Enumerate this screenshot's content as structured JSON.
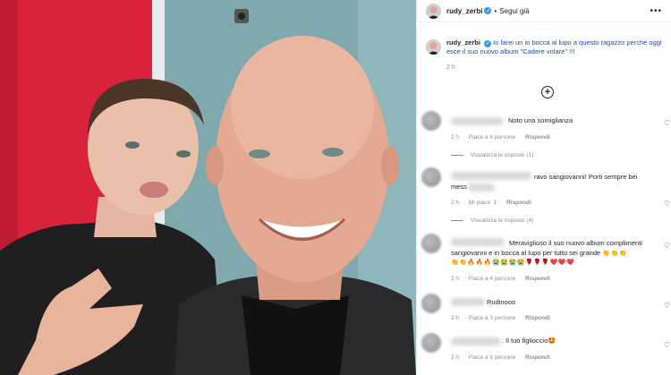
{
  "post": {
    "username": "rudy_zerbi",
    "follow_state": "Segui già",
    "caption": "Io farei un in bocca al lupo a questo ragazzo perché oggi esce il suo nuovo album \"Cadere volare\" !!!",
    "time": "2 h"
  },
  "comments": [
    {
      "text": "Noto una somiglianza",
      "time": "2 h",
      "likes": "Piace a 8 persone",
      "reply": "Rispondi"
    },
    {
      "text": "ravo sangiovanni! Porti sempre bei",
      "text2": "mess",
      "time": "2 h",
      "likes": "Mi piace: 1",
      "reply": "Rispondi",
      "replies_view": "Visualizza le risposte (1)"
    },
    {
      "text": "Meraviglioso il suo nuovo album complimenti",
      "text2": "sangiovanni e in bocca al lupo per tutto sei grande",
      "emoji_trail": "👏👏👏",
      "emoji_line": "👏👏🔥🔥🔥😭😭😭😭🌹🌹🌹❤️❤️❤️",
      "time": "2 h",
      "likes": "Piace a 4 persone",
      "reply": "Rispondi",
      "replies_view_above": "Visualizza le risposte (4)"
    },
    {
      "text": "Rudinooo",
      "time": "2 h",
      "likes": "Piace a 3 persone",
      "reply": "Rispondi"
    },
    {
      "text": ". Il tuo figlioccio🤩",
      "time": "2 h",
      "likes": "Piace a 6 persone",
      "reply": "Rispondi"
    }
  ],
  "icons": {
    "verified": "verified-badge-icon",
    "more": "more-options-icon",
    "add": "add-circle-icon",
    "heart": "heart-icon"
  },
  "colors": {
    "verified": "#3897f0",
    "caption_link": "#1f4fa8",
    "photo_left_wall": "#d8233a",
    "photo_right_wall": "#7fa9ad"
  }
}
